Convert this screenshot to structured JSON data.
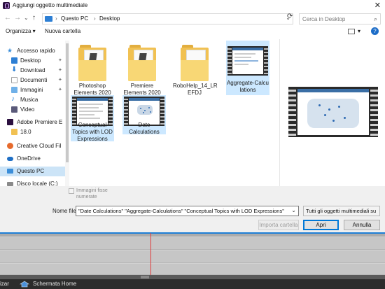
{
  "window": {
    "title": "Aggiungi oggetto multimediale",
    "close_glyph": "✕"
  },
  "nav": {
    "back_glyph": "←",
    "forward_glyph": "→",
    "recent_glyph": "⌄",
    "up_glyph": "↑",
    "breadcrumb": [
      "Questo PC",
      "Desktop"
    ],
    "separator": "›",
    "refresh_glyph": "⟳",
    "search_placeholder": "Cerca in Desktop"
  },
  "toolbar": {
    "organize": "Organizza ▾",
    "new_folder": "Nuova cartella",
    "view_menu_glyph": "▾",
    "help_glyph": "?"
  },
  "sidebar": {
    "items": [
      {
        "label": "Accesso rapido",
        "icon": "star-icon",
        "color": "#3b8ed9",
        "pinned": false
      },
      {
        "label": "Desktop",
        "icon": "desktop-icon",
        "color": "#2d7fd4",
        "pinned": true
      },
      {
        "label": "Download",
        "icon": "download-icon",
        "color": "#2d7fd4",
        "pinned": true
      },
      {
        "label": "Documenti",
        "icon": "documents-icon",
        "color": "#b0b0b0",
        "pinned": true
      },
      {
        "label": "Immagini",
        "icon": "pictures-icon",
        "color": "#3b8ed9",
        "pinned": true
      },
      {
        "label": "Musica",
        "icon": "music-icon",
        "color": "#3b8ed9",
        "pinned": false
      },
      {
        "label": "Video",
        "icon": "video-icon",
        "color": "#5a5a7a",
        "pinned": false
      },
      {
        "label": "Adobe Premiere E",
        "icon": "premiere-icon",
        "color": "#2b0f3f",
        "pinned": false
      },
      {
        "label": "18.0",
        "icon": "folder-icon",
        "color": "#f1c152",
        "pinned": false
      },
      {
        "label": "Creative Cloud Fil",
        "icon": "creative-cloud-icon",
        "color": "#e66a2c",
        "pinned": false
      },
      {
        "label": "OneDrive",
        "icon": "onedrive-icon",
        "color": "#1f6fc5",
        "pinned": false
      },
      {
        "label": "Questo PC",
        "icon": "pc-icon",
        "color": "#3b8ed9",
        "pinned": false
      },
      {
        "label": "Disco locale (C:)",
        "icon": "drive-icon",
        "color": "#8a8a8a",
        "pinned": false
      }
    ],
    "pin_glyph": "📌"
  },
  "files": [
    {
      "name": "Photoshop Elements 2020",
      "kind": "folder",
      "selected": false
    },
    {
      "name": "Premiere Elements 2020",
      "kind": "folder",
      "selected": false
    },
    {
      "name": "RoboHelp_14_LR EFDJ",
      "kind": "folder",
      "selected": false
    },
    {
      "name": "Aggregate-Calcu lations",
      "kind": "video",
      "selected": true
    },
    {
      "name": "Conceptual Topics with LOD Expressions",
      "kind": "video",
      "selected": true
    },
    {
      "name": "Date Calculations",
      "kind": "video",
      "selected": true
    }
  ],
  "bottom": {
    "still_images_label": "Immagini fisse numerate",
    "filename_label": "Nome file:",
    "filename_value": "\"Date Calculations\" \"Aggregate-Calculations\" \"Conceptual Topics with LOD Expressions\"",
    "filetype_value": "Tutti gli oggetti multimediali su",
    "import_folder": "Importa cartella",
    "open": "Apri",
    "cancel": "Annulla",
    "dropdown_glyph": "⌄"
  },
  "app": {
    "home_label": "Schermata Home",
    "left_label": "izar"
  },
  "colors": {
    "selection": "#cce8ff",
    "accent": "#0078d7",
    "playhead": "#e03a3a"
  }
}
